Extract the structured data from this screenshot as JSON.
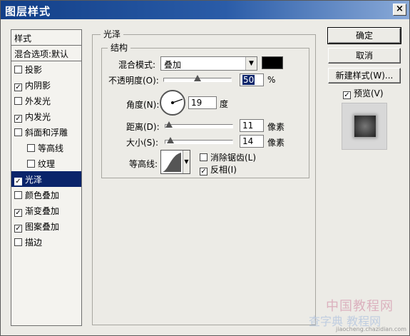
{
  "window": {
    "title": "图层样式",
    "close_label": "×"
  },
  "style_list": {
    "header": "样式",
    "blend_options": "混合选项:默认",
    "items": [
      {
        "label": "投影",
        "checked": false
      },
      {
        "label": "内阴影",
        "checked": true
      },
      {
        "label": "外发光",
        "checked": false
      },
      {
        "label": "内发光",
        "checked": true
      },
      {
        "label": "斜面和浮雕",
        "checked": false
      },
      {
        "label": "等高线",
        "checked": false
      },
      {
        "label": "纹理",
        "checked": false
      },
      {
        "label": "光泽",
        "checked": true,
        "selected": true
      },
      {
        "label": "颜色叠加",
        "checked": false
      },
      {
        "label": "渐变叠加",
        "checked": true
      },
      {
        "label": "图案叠加",
        "checked": true
      },
      {
        "label": "描边",
        "checked": false
      }
    ]
  },
  "satin": {
    "group_title": "光泽",
    "structure_title": "结构",
    "blend_mode_label": "混合模式:",
    "blend_mode_value": "叠加",
    "blend_color": "#000000",
    "opacity_label": "不透明度(O):",
    "opacity_value": "50",
    "opacity_unit": "%",
    "opacity_fraction": 0.5,
    "angle_label": "角度(N):",
    "angle_value": "19",
    "angle_unit": "度",
    "distance_label": "距离(D):",
    "distance_value": "11",
    "distance_unit": "像素",
    "size_label": "大小(S):",
    "size_value": "14",
    "size_unit": "像素",
    "contour_label": "等高线:",
    "anti_alias_label": "消除锯齿(L)",
    "anti_alias_checked": false,
    "invert_label": "反相(I)",
    "invert_checked": true
  },
  "buttons": {
    "ok": "确定",
    "cancel": "取消",
    "new_style": "新建样式(W)...",
    "preview_label": "预览(V)",
    "preview_checked": true
  },
  "watermark": {
    "line1": "中国教程网",
    "line2": "查字典 教程网",
    "line3": "jiaocheng.chazidian.com"
  }
}
